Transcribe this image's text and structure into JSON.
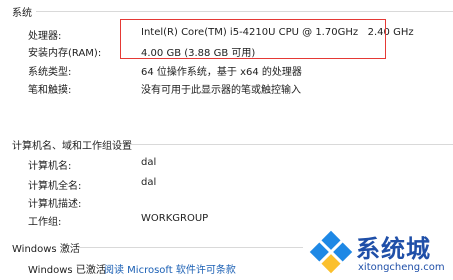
{
  "system": {
    "title": "系统",
    "rows": [
      {
        "label": "处理器:",
        "value": "Intel(R) Core(TM) i5-4210U CPU @ 1.70GHz   2.40 GHz"
      },
      {
        "label": "安装内存(RAM):",
        "value": "4.00 GB (3.88 GB 可用)"
      },
      {
        "label": "系统类型:",
        "value": "64 位操作系统，基于 x64 的处理器"
      },
      {
        "label": "笔和触摸:",
        "value": "没有可用于此显示器的笔或触控输入"
      }
    ]
  },
  "computer": {
    "title": "计算机名、域和工作组设置",
    "rows": [
      {
        "label": "计算机名:",
        "value": "dal"
      },
      {
        "label": "计算机全名:",
        "value": "dal"
      },
      {
        "label": "计算机描述:",
        "value": ""
      },
      {
        "label": "工作组:",
        "value": "WORKGROUP"
      }
    ]
  },
  "activation": {
    "title": "Windows 激活",
    "status": "Windows 已激活",
    "link": "阅读 Microsoft 软件许可条款"
  },
  "watermark": {
    "brand": "系统城",
    "url": "xitongcheng.com"
  },
  "colors": {
    "highlight": "#e53935",
    "link": "#1a5fb4",
    "watermark": "#1f4fa8"
  }
}
